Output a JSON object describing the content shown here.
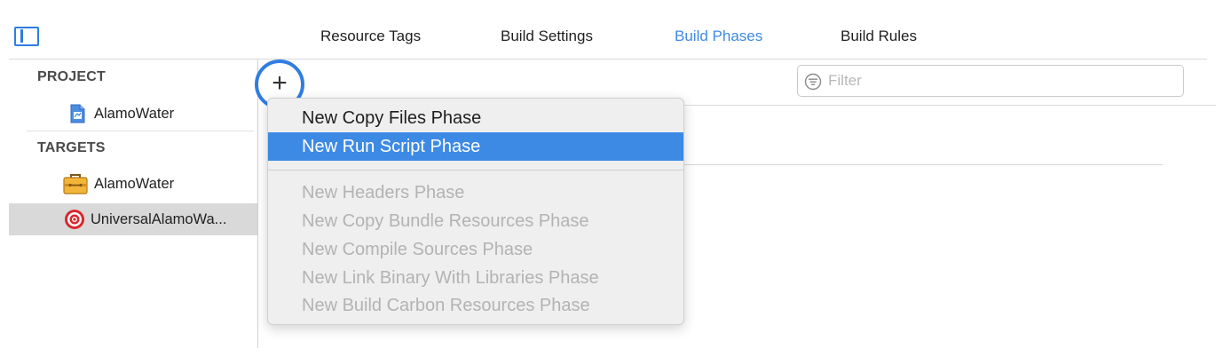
{
  "toolbar": {
    "tabs": [
      {
        "label": "Resource Tags",
        "active": false
      },
      {
        "label": "Build Settings",
        "active": false
      },
      {
        "label": "Build Phases",
        "active": true
      },
      {
        "label": "Build Rules",
        "active": false
      }
    ]
  },
  "sidebar": {
    "project_header": "PROJECT",
    "project_items": [
      {
        "label": "AlamoWater",
        "icon": "project-file-icon"
      }
    ],
    "targets_header": "TARGETS",
    "target_items": [
      {
        "label": "AlamoWater",
        "icon": "app-target-icon",
        "selected": false
      },
      {
        "label": "UniversalAlamoWa...",
        "icon": "aggregate-target-icon",
        "selected": true
      }
    ]
  },
  "editor": {
    "add_button_label": "+",
    "filter_placeholder": "Filter",
    "filter_value": ""
  },
  "add_phase_menu": {
    "items": [
      {
        "label": "New Copy Files Phase",
        "state": "enabled"
      },
      {
        "label": "New Run Script Phase",
        "state": "highlighted"
      },
      {
        "label": "New Headers Phase",
        "state": "disabled"
      },
      {
        "label": "New Copy Bundle Resources Phase",
        "state": "disabled"
      },
      {
        "label": "New Compile Sources Phase",
        "state": "disabled"
      },
      {
        "label": "New Link Binary With Libraries Phase",
        "state": "disabled"
      },
      {
        "label": "New Build Carbon Resources Phase",
        "state": "disabled"
      }
    ]
  },
  "colors": {
    "accent": "#3d8ae5",
    "selection_gray": "#d9d9d9",
    "disabled_text": "#b3b3b3"
  }
}
